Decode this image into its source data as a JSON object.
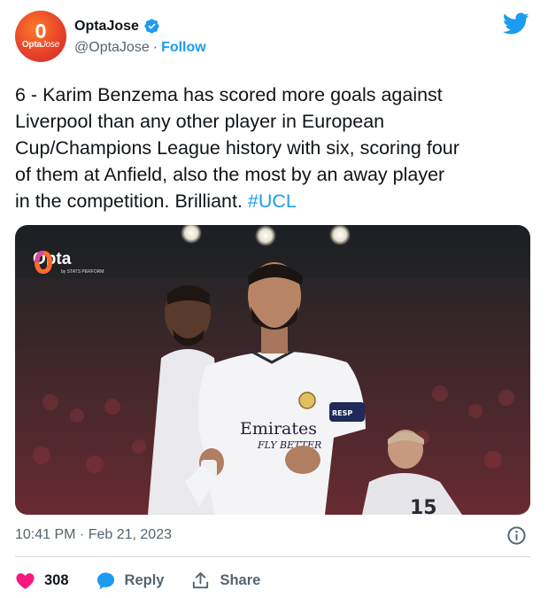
{
  "author": {
    "avatar_text": "Opta",
    "avatar_text2": "Jose",
    "display_name": "OptaJose",
    "handle": "@OptaJose",
    "separator": "·",
    "follow_label": "Follow"
  },
  "tweet": {
    "text": "6 - Karim Benzema has scored more goals against\nLiverpool than any other player in European\nCup/Champions League history with six, scoring four\nof them at Anfield, also the most by an away player\nin the competition. Brilliant. ",
    "hashtag": "#UCL"
  },
  "media": {
    "badge_text": "Opta",
    "badge_sub": "by STATS PERFORM",
    "shirt_sponsor": "Emirates",
    "shirt_sponsor_sub": "FLY BETTER",
    "armband_text": "RESP",
    "back_number": "15"
  },
  "meta": {
    "time": "10:41 PM · Feb 21, 2023"
  },
  "actions": {
    "like_count": "308",
    "reply_label": "Reply",
    "share_label": "Share"
  },
  "colors": {
    "twitter_blue": "#1d9bf0",
    "like_red": "#f91880",
    "avatar_orange": "#e8432a"
  },
  "icons": [
    "verified-badge-icon",
    "twitter-bird-icon",
    "info-icon",
    "heart-icon",
    "reply-bubble-icon",
    "share-icon"
  ]
}
